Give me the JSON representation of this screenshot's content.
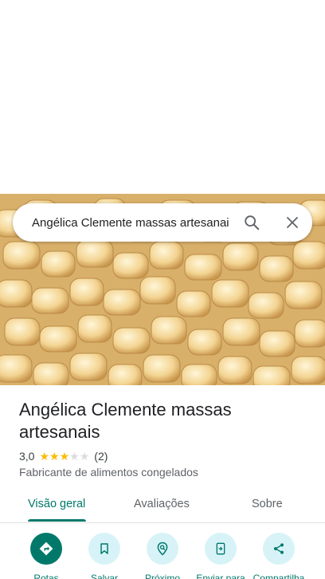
{
  "search": {
    "query": "Angélica Clemente massas artesanais"
  },
  "place": {
    "title": "Angélica Clemente massas artesanais",
    "rating_value": "3,0",
    "stars": 3,
    "review_count": "(2)",
    "category": "Fabricante de alimentos congelados"
  },
  "tabs": [
    "Visão geral",
    "Avaliações",
    "Sobre"
  ],
  "actions": {
    "rotas": "Rotas",
    "salvar": "Salvar",
    "proximo": "Próximo",
    "enviar": "Enviar para",
    "compartilhar": "Compartilha"
  },
  "colors": {
    "accent": "#00796b",
    "action_bg": "#d7f3f7",
    "star": "#fbbc04"
  }
}
